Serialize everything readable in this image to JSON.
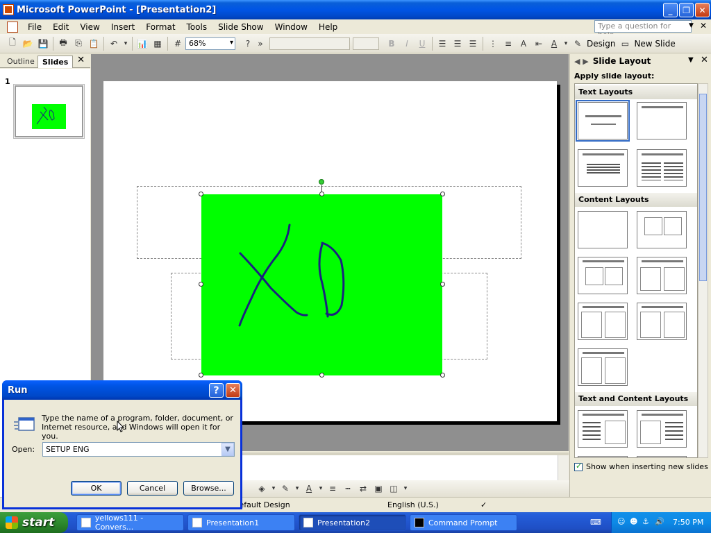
{
  "window": {
    "title": "Microsoft PowerPoint - [Presentation2]"
  },
  "menu": {
    "items": [
      "File",
      "Edit",
      "View",
      "Insert",
      "Format",
      "Tools",
      "Slide Show",
      "Window",
      "Help"
    ],
    "help_placeholder": "Type a question for help"
  },
  "toolbar": {
    "zoom": "68%",
    "design_label": "Design",
    "new_slide_label": "New Slide"
  },
  "left_pane": {
    "tab_outline": "Outline",
    "tab_slides": "Slides",
    "slide_number": "1"
  },
  "task_pane": {
    "title": "Slide Layout",
    "apply_label": "Apply slide layout:",
    "groups": [
      "Text Layouts",
      "Content Layouts",
      "Text and Content Layouts"
    ],
    "show_when_label": "Show when inserting new slides"
  },
  "status_bar": {
    "design": "Default Design",
    "language": "English (U.S.)"
  },
  "run_dialog": {
    "title": "Run",
    "description": "Type the name of a program, folder, document, or Internet resource, and Windows will open it for you.",
    "open_label": "Open:",
    "open_value": "SETUP ENG",
    "ok_label": "OK",
    "cancel_label": "Cancel",
    "browse_label": "Browse..."
  },
  "taskbar": {
    "start_label": "start",
    "tasks": [
      "yellows111 - Convers...",
      "Presentation1",
      "Presentation2",
      "Command Prompt"
    ],
    "clock": "7:50 PM"
  },
  "colors": {
    "slide_object": "#00ff00",
    "ink": "#1a237e",
    "title_bar": "#0055e5"
  }
}
